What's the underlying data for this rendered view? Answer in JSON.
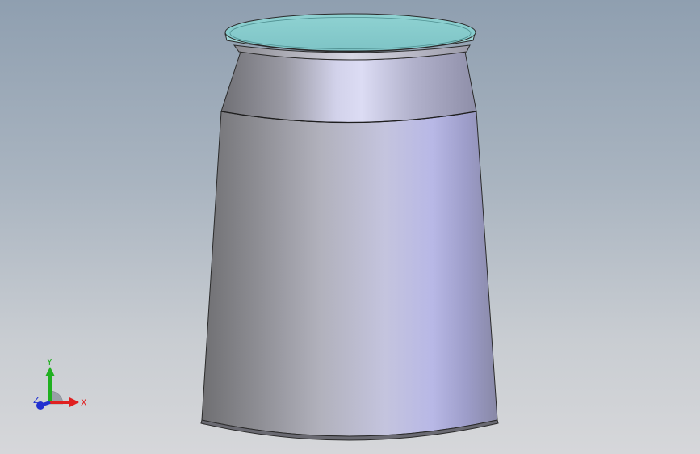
{
  "viewport": {
    "colors": {
      "background_top": "#8f9fb0",
      "background_bottom": "#d6d7da",
      "body_metal": "#a8aab8",
      "lid_face": "#8ecfd0"
    }
  },
  "triad": {
    "x_label": "X",
    "y_label": "Y",
    "z_label": "Z",
    "colors": {
      "x": "#e02020",
      "y": "#20b020",
      "z": "#2030d0"
    }
  }
}
